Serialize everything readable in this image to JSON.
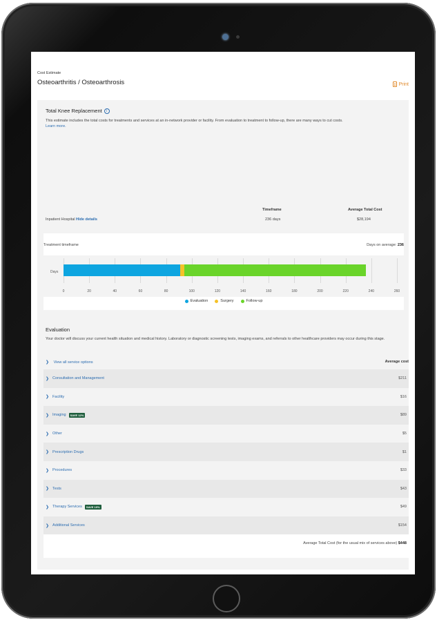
{
  "header": {
    "breadcrumb": "Cost Estimate",
    "title": "Osteoarthritis / Osteoarthrosis",
    "print_label": "Print"
  },
  "procedure": {
    "title": "Total Knee Replacement",
    "info_glyph": "i",
    "description": "This estimate includes the total costs for treatments and services at an in-network provider or facility. From evaluation to treatment to follow-up, there are many ways to cut costs.",
    "learn_more": "Learn more."
  },
  "summary": {
    "col_timeframe": "Timeframe",
    "col_avg_cost": "Average Total Cost",
    "provider": "Inpatient Hospital",
    "hide_details": "Hide details",
    "timeframe": "236 days",
    "avg_cost": "$28,194"
  },
  "timeline": {
    "title": "Treatment timeframe",
    "days_avg_label": "Days on average:",
    "days_avg_value": "236",
    "row_label": "Days",
    "legend": [
      "Evaluation",
      "Surgery",
      "Follow-up"
    ],
    "colors": {
      "evaluation": "#0ea5e0",
      "surgery": "#f5c228",
      "followup": "#6ad42a"
    }
  },
  "chart_data": {
    "type": "bar",
    "orientation": "horizontal-stacked",
    "categories": [
      "Days"
    ],
    "series": [
      {
        "name": "Evaluation",
        "values": [
          91
        ]
      },
      {
        "name": "Surgery",
        "values": [
          3
        ]
      },
      {
        "name": "Follow-up",
        "values": [
          142
        ]
      }
    ],
    "xlim": [
      0,
      260
    ],
    "xticks": [
      0,
      20,
      40,
      60,
      80,
      100,
      120,
      140,
      160,
      180,
      200,
      220,
      240,
      260
    ],
    "grid": true,
    "legend_placement": "bottom"
  },
  "evaluation": {
    "title": "Evaluation",
    "description": "Your doctor will discuss your current health situation and medical history. Laboratory or diagnostic screening tests, imaging exams, and referrals to other healthcare providers may occur during this stage.",
    "view_all": "View all service options",
    "avg_cost_header": "Average cost",
    "services": [
      {
        "name": "Consultation and Management",
        "cost": "$211",
        "badge": ""
      },
      {
        "name": "Facility",
        "cost": "$16",
        "badge": ""
      },
      {
        "name": "Imaging",
        "cost": "$89",
        "badge": "SAVE 12%"
      },
      {
        "name": "Other",
        "cost": "$5",
        "badge": ""
      },
      {
        "name": "Prescription Drugs",
        "cost": "$1",
        "badge": ""
      },
      {
        "name": "Procedures",
        "cost": "$33",
        "badge": ""
      },
      {
        "name": "Tests",
        "cost": "$43",
        "badge": ""
      },
      {
        "name": "Therapy Services",
        "cost": "$49",
        "badge": "SAVE 19%"
      },
      {
        "name": "Additional Services",
        "cost": "$154",
        "badge": ""
      }
    ],
    "total_label": "Average Total Cost (for the usual mix of services above)",
    "total_value": "$448"
  }
}
